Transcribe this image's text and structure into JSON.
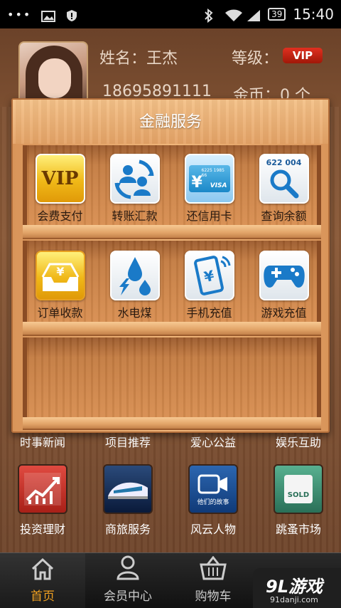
{
  "status_bar": {
    "dots": "•••",
    "battery": "39",
    "time": "15:40"
  },
  "profile": {
    "name": "姓名：王杰",
    "level_label": "等级：",
    "level_badge": "VIP",
    "phone": "18695891111",
    "coins": "金币：0 个"
  },
  "popup": {
    "title": "金融服务",
    "row1": [
      {
        "label": "会费支付",
        "icon": "vip-icon"
      },
      {
        "label": "转账汇款",
        "icon": "transfer-icon"
      },
      {
        "label": "还信用卡",
        "icon": "credit-card-icon"
      },
      {
        "label": "查询余额",
        "icon": "balance-search-icon"
      }
    ],
    "row2": [
      {
        "label": "订单收款",
        "icon": "order-inbox-icon"
      },
      {
        "label": "水电煤",
        "icon": "utilities-icon"
      },
      {
        "label": "手机充值",
        "icon": "mobile-recharge-icon"
      },
      {
        "label": "游戏充值",
        "icon": "gamepad-icon"
      }
    ],
    "vip_text": "VIP",
    "card_number_small": "6225 1985 66",
    "card_brand": "VISA",
    "search_digits": "622 004",
    "yen": "¥"
  },
  "categories": [
    "时事新闻",
    "项目推荐",
    "爱心公益",
    "娱乐互助"
  ],
  "features": [
    {
      "label": "投资理财",
      "icon": "investment-chart-icon",
      "color": "#c8302a"
    },
    {
      "label": "商旅服务",
      "icon": "train-icon",
      "color": "#1a3a6a"
    },
    {
      "label": "风云人物",
      "icon": "video-story-icon",
      "color": "#1a4a8a",
      "tile_text": "他们的故事"
    },
    {
      "label": "跳蚤市场",
      "icon": "sold-bag-icon",
      "color": "#3a8a70",
      "tile_text": "SOLD"
    }
  ],
  "bottom_nav": [
    {
      "label": "首页",
      "icon": "home-icon",
      "active": true
    },
    {
      "label": "会员中心",
      "icon": "user-icon",
      "active": false
    },
    {
      "label": "购物车",
      "icon": "basket-icon",
      "active": false
    }
  ],
  "watermark": {
    "main": "9L游戏",
    "sub": "91danji.com"
  },
  "colors": {
    "accent": "#f0a020",
    "vip_red": "#c02010",
    "wood_light": "#f0b67a",
    "wood_dark": "#8a4c24"
  }
}
